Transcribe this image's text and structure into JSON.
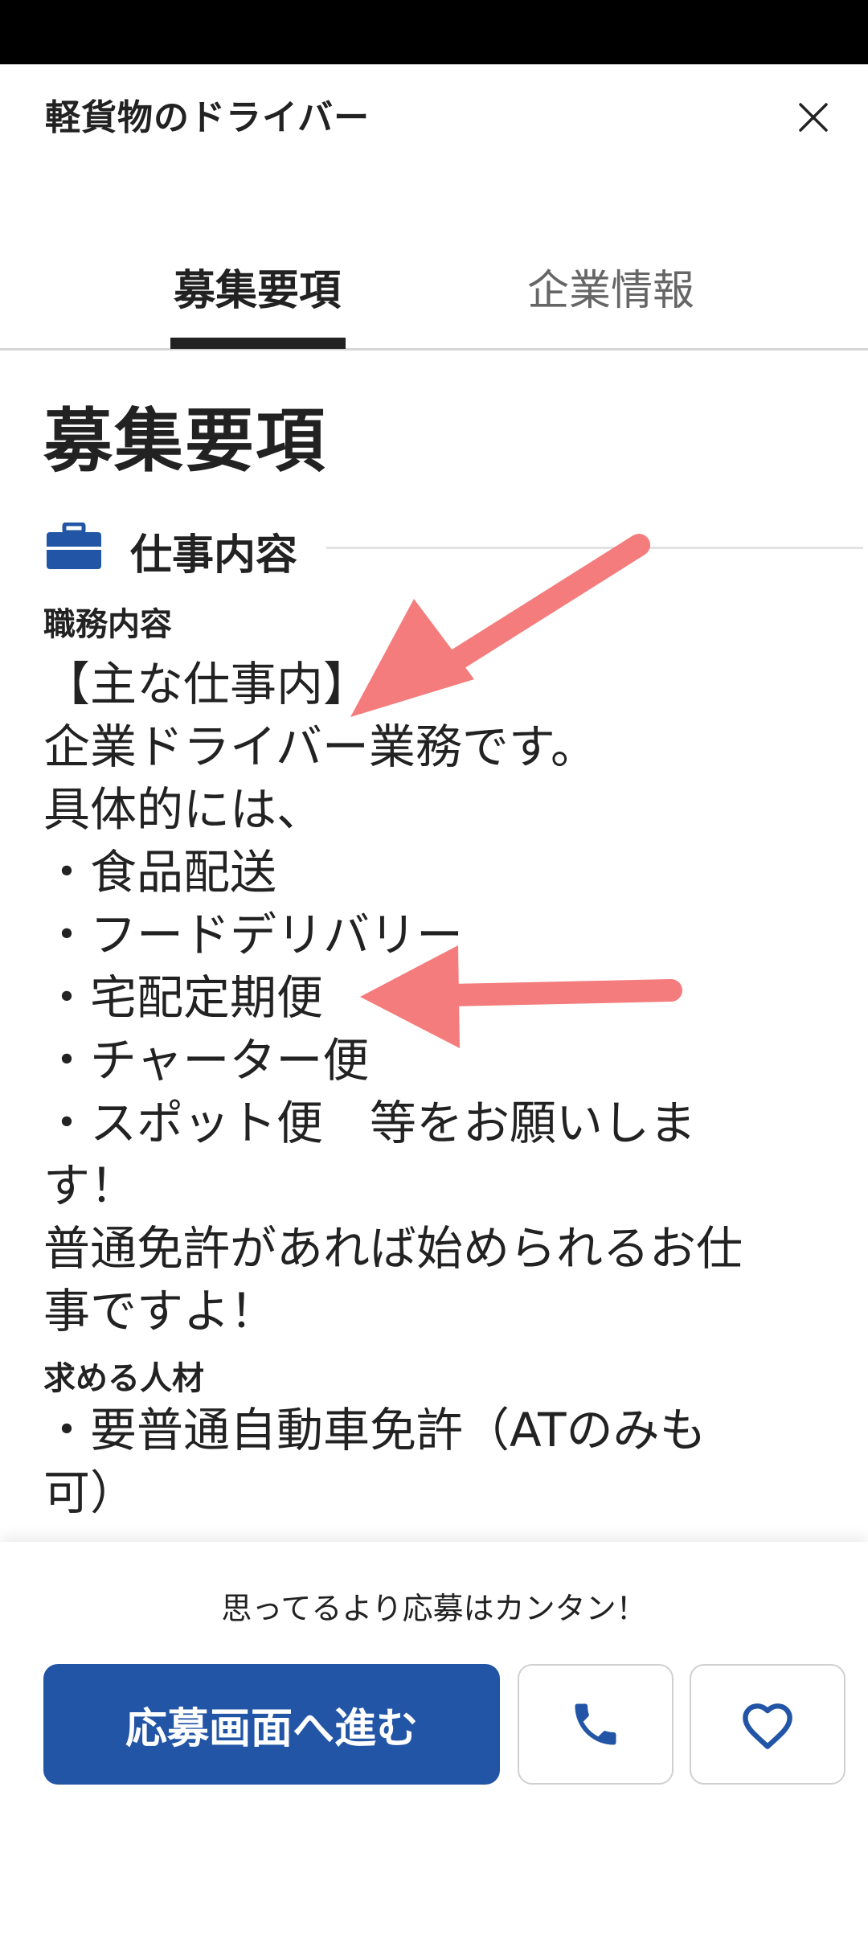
{
  "header": {
    "title": "軽貨物のドライバー",
    "close_icon": "close-icon"
  },
  "tabs": [
    {
      "label": "募集要項",
      "active": true
    },
    {
      "label": "企業情報",
      "active": false
    }
  ],
  "content": {
    "section_title": "募集要項",
    "subsection": {
      "icon": "briefcase-icon",
      "title": "仕事内容"
    },
    "duties": {
      "label": "職務内容",
      "text": "【主な仕事内】\n企業ドライバー業務です。\n具体的には、\n・食品配送\n・フードデリバリー\n・宅配定期便\n・チャーター便\n・スポット便　等をお願いしま\nす！\n普通免許があれば始められるお仕\n事ですよ！"
    },
    "requirements": {
      "label": "求める人材",
      "text": "・要普通自動車免許（ATのみも\n可）"
    }
  },
  "bottom_bar": {
    "promo_text": "思ってるより応募はカンタン！",
    "apply_label": "応募画面へ進む",
    "phone_icon": "phone-icon",
    "favorite_icon": "heart-icon"
  },
  "colors": {
    "accent": "#2255a5",
    "annotation_arrow": "#f47c7c"
  }
}
